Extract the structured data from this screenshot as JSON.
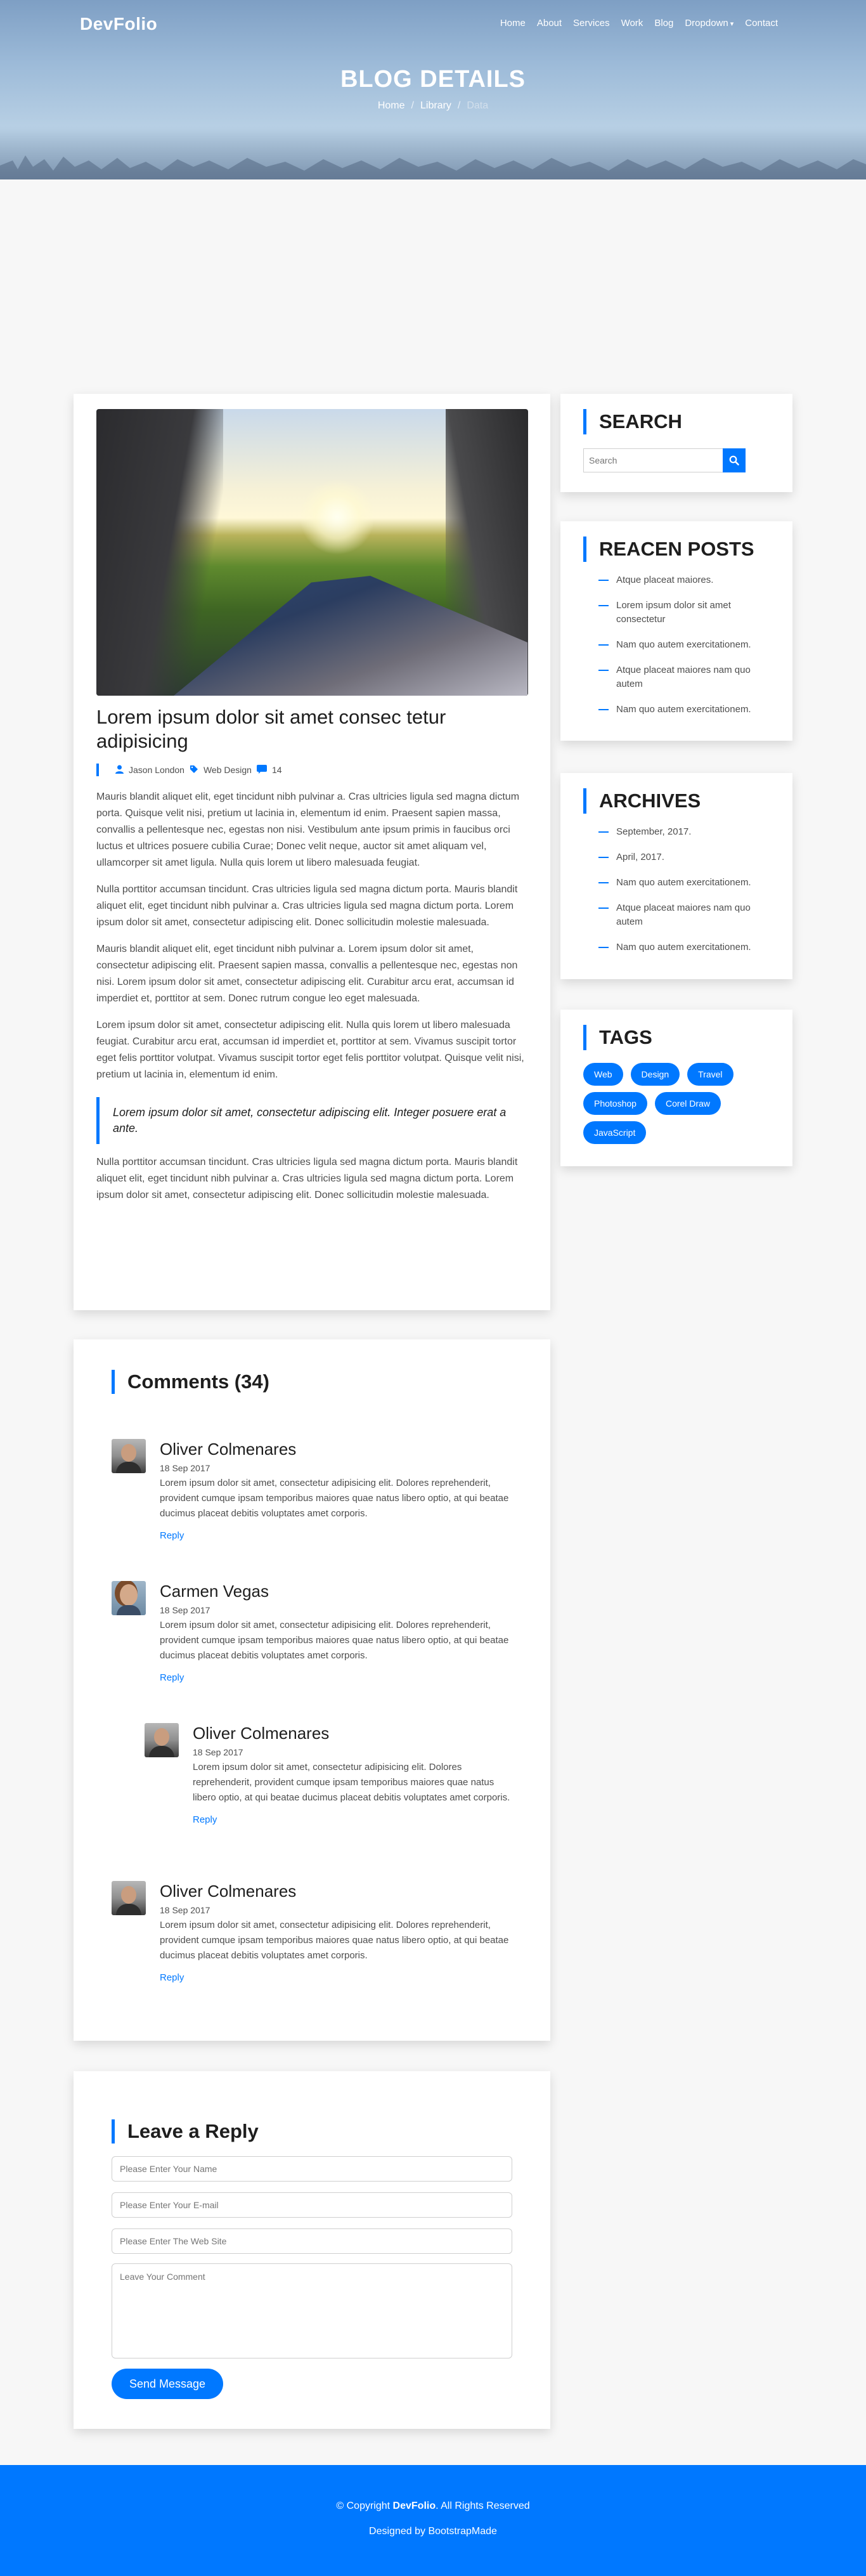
{
  "brand": "DevFolio",
  "nav": [
    {
      "label": "Home"
    },
    {
      "label": "About"
    },
    {
      "label": "Services"
    },
    {
      "label": "Work"
    },
    {
      "label": "Blog"
    },
    {
      "label": "Dropdown"
    },
    {
      "label": "Contact"
    }
  ],
  "hero": {
    "title": "BLOG DETAILS",
    "breadcrumb": [
      "Home",
      "Library",
      "Data"
    ]
  },
  "post": {
    "title": "Lorem ipsum dolor sit amet consec tetur adipisicing",
    "author": "Jason London",
    "category": "Web Design",
    "comment_count": "14",
    "paragraphs": [
      "Mauris blandit aliquet elit, eget tincidunt nibh pulvinar a. Cras ultricies ligula sed magna dictum porta. Quisque velit nisi, pretium ut lacinia in, elementum id enim. Praesent sapien massa, convallis a pellentesque nec, egestas non nisi. Vestibulum ante ipsum primis in faucibus orci luctus et ultrices posuere cubilia Curae; Donec velit neque, auctor sit amet aliquam vel, ullamcorper sit amet ligula. Nulla quis lorem ut libero malesuada feugiat.",
      "Nulla porttitor accumsan tincidunt. Cras ultricies ligula sed magna dictum porta. Mauris blandit aliquet elit, eget tincidunt nibh pulvinar a. Cras ultricies ligula sed magna dictum porta. Lorem ipsum dolor sit amet, consectetur adipiscing elit. Donec sollicitudin molestie malesuada.",
      "Mauris blandit aliquet elit, eget tincidunt nibh pulvinar a. Lorem ipsum dolor sit amet, consectetur adipiscing elit. Praesent sapien massa, convallis a pellentesque nec, egestas non nisi. Lorem ipsum dolor sit amet, consectetur adipiscing elit. Curabitur arcu erat, accumsan id imperdiet et, porttitor at sem. Donec rutrum congue leo eget malesuada.",
      "Lorem ipsum dolor sit amet, consectetur adipiscing elit. Nulla quis lorem ut libero malesuada feugiat. Curabitur arcu erat, accumsan id imperdiet et, porttitor at sem. Vivamus suscipit tortor eget felis porttitor volutpat. Vivamus suscipit tortor eget felis porttitor volutpat. Quisque velit nisi, pretium ut lacinia in, elementum id enim."
    ],
    "quote": "Lorem ipsum dolor sit amet, consectetur adipiscing elit. Integer posuere erat a ante.",
    "closing": "Nulla porttitor accumsan tincidunt. Cras ultricies ligula sed magna dictum porta. Mauris blandit aliquet elit, eget tincidunt nibh pulvinar a. Cras ultricies ligula sed magna dictum porta. Lorem ipsum dolor sit amet, consectetur adipiscing elit. Donec sollicitudin molestie malesuada."
  },
  "comments": {
    "title": "Comments (34)",
    "reply_label": "Reply",
    "items": [
      {
        "name": "Oliver Colmenares",
        "date": "18 Sep 2017",
        "text": "Lorem ipsum dolor sit amet, consectetur adipisicing elit. Dolores reprehenderit, provident cumque ipsam temporibus maiores quae natus libero optio, at qui beatae ducimus placeat debitis voluptates amet corporis.",
        "avatar": "man-glasses"
      },
      {
        "name": "Carmen Vegas",
        "date": "18 Sep 2017",
        "text": "Lorem ipsum dolor sit amet, consectetur adipisicing elit. Dolores reprehenderit, provident cumque ipsam temporibus maiores quae natus libero optio, at qui beatae ducimus placeat debitis voluptates amet corporis.",
        "avatar": "woman"
      },
      {
        "name": "Oliver Colmenares",
        "date": "18 Sep 2017",
        "text": "Lorem ipsum dolor sit amet, consectetur adipisicing elit. Dolores reprehenderit, provident cumque ipsam temporibus maiores quae natus libero optio, at qui beatae ducimus placeat debitis voluptates amet corporis.",
        "avatar": "man-glasses"
      },
      {
        "name": "Oliver Colmenares",
        "date": "18 Sep 2017",
        "text": "Lorem ipsum dolor sit amet, consectetur adipisicing elit. Dolores reprehenderit, provident cumque ipsam temporibus maiores quae natus libero optio, at qui beatae ducimus placeat debitis voluptates amet corporis.",
        "avatar": "man-glasses"
      }
    ]
  },
  "reply_form": {
    "title": "Leave a Reply",
    "name_placeholder": "Please Enter Your Name",
    "email_placeholder": "Please Enter Your E-mail",
    "website_placeholder": "Please Enter The Web Site",
    "comment_placeholder": "Leave Your Comment",
    "submit": "Send Message"
  },
  "sidebar": {
    "search": {
      "title": "Search",
      "placeholder": "Search"
    },
    "recent": {
      "title": "Reacen Posts",
      "items": [
        "Atque placeat maiores.",
        "Lorem ipsum dolor sit amet consectetur",
        "Nam quo autem exercitationem.",
        "Atque placeat maiores nam quo autem",
        "Nam quo autem exercitationem."
      ]
    },
    "archives": {
      "title": "Archives",
      "items": [
        "September, 2017.",
        "April, 2017.",
        "Nam quo autem exercitationem.",
        "Atque placeat maiores nam quo autem",
        "Nam quo autem exercitationem."
      ]
    },
    "tags": {
      "title": "Tags",
      "items": [
        "Web",
        "Design",
        "Travel",
        "Photoshop",
        "Corel Draw",
        "JavaScript"
      ]
    }
  },
  "footer": {
    "copy_prefix": "© Copyright",
    "copy_brand": "DevFolio",
    "copy_suffix": ". All Rights Reserved",
    "designed": "Designed by BootstrapMade"
  },
  "colors": {
    "accent": "#0078ff",
    "footer": "#0078ff",
    "background": "#f7f7f7"
  }
}
